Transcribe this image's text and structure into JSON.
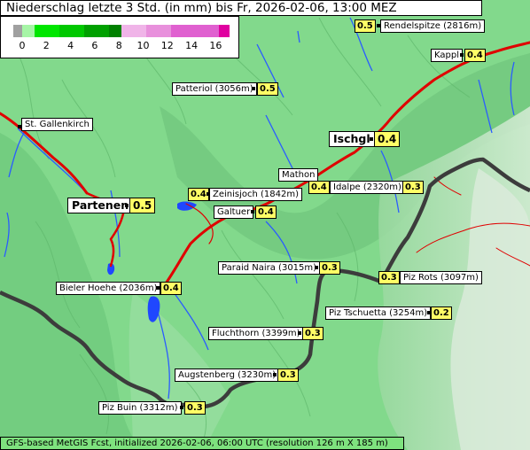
{
  "title": "Niederschlag letzte 3 Std. (in mm) bis Fr, 2026-02-06, 13:00 MEZ",
  "legend": {
    "ticks": [
      "0",
      "2",
      "4",
      "6",
      "8",
      "10",
      "12",
      "14",
      "16"
    ],
    "colors": [
      "#a0a0a0",
      "#a6f5a6",
      "#00e600",
      "#00c800",
      "#00a000",
      "#008000",
      "#f0b4e8",
      "#e890dc",
      "#e060d0",
      "#e000a0"
    ]
  },
  "places": [
    {
      "name": "Rendelspitze (2816m)",
      "value": "0.5"
    },
    {
      "name": "Kappl",
      "value": "0.4"
    },
    {
      "name": "Patteriol (3056m)",
      "value": "0.5"
    },
    {
      "name": "St. Gallenkirch",
      "value": ""
    },
    {
      "name": "Ischgl",
      "value": "0.4"
    },
    {
      "name": "Mathon",
      "value": ""
    },
    {
      "name": "Idalpe (2320m)",
      "value": "0.3"
    },
    {
      "name": "Zeinisjoch (1842m)",
      "value": "0.4"
    },
    {
      "name": "Partenen",
      "value": "0.5"
    },
    {
      "name": "Galtuer",
      "value": "0.4"
    },
    {
      "name": "Paraid Naira (3015m)",
      "value": "0.3"
    },
    {
      "name": "Piz Rots (3097m)",
      "value": "0.3"
    },
    {
      "name": "Bieler Hoehe (2036m)",
      "value": "0.4"
    },
    {
      "name": "Piz Tschuetta (3254m)",
      "value": "0.2"
    },
    {
      "name": "Fluchthorn (3399m)",
      "value": "0.3"
    },
    {
      "name": "Augstenberg (3230m)",
      "value": "0.3"
    },
    {
      "name": "Piz Buin (3312m)",
      "value": "0.3"
    },
    {
      "name": "Mathon_val",
      "value": "0.4"
    }
  ],
  "footer": "GFS-based MetGIS Fcst, initialized 2026-02-06, 06:00 UTC  (resolution 126 m X 185 m)"
}
